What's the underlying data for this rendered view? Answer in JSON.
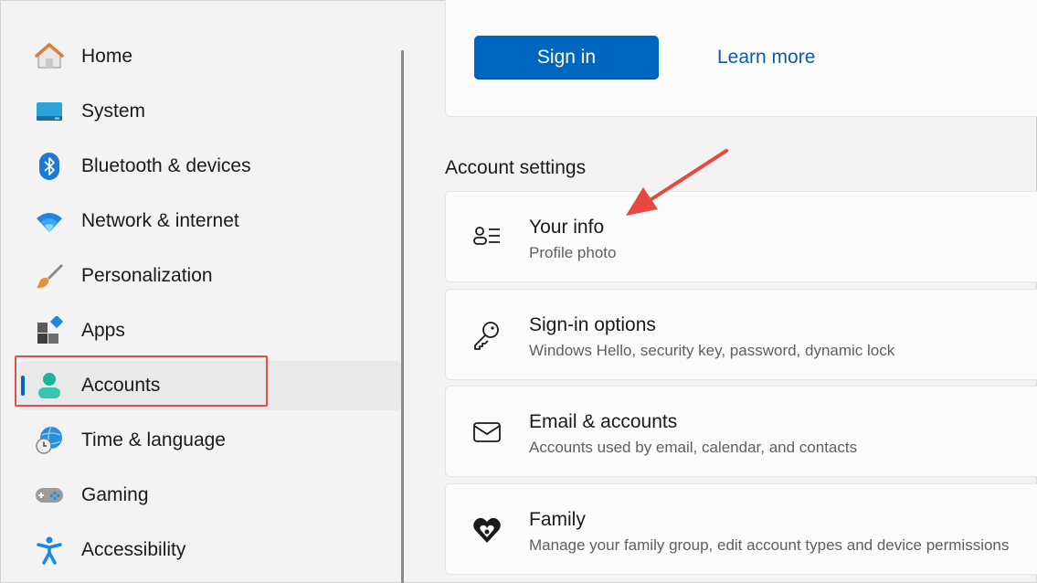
{
  "sidebar": {
    "items": [
      {
        "label": "Home",
        "icon": "home-icon"
      },
      {
        "label": "System",
        "icon": "system-icon"
      },
      {
        "label": "Bluetooth & devices",
        "icon": "bluetooth-icon"
      },
      {
        "label": "Network & internet",
        "icon": "wifi-icon"
      },
      {
        "label": "Personalization",
        "icon": "brush-icon"
      },
      {
        "label": "Apps",
        "icon": "apps-icon"
      },
      {
        "label": "Accounts",
        "icon": "accounts-icon",
        "active": true
      },
      {
        "label": "Time & language",
        "icon": "time-language-icon"
      },
      {
        "label": "Gaming",
        "icon": "gamepad-icon"
      },
      {
        "label": "Accessibility",
        "icon": "accessibility-icon"
      }
    ]
  },
  "main": {
    "signin_label": "Sign in",
    "learn_more_label": "Learn more",
    "section_title": "Account settings",
    "cards": [
      {
        "title": "Your info",
        "subtitle": "Profile photo",
        "icon": "person-list-icon"
      },
      {
        "title": "Sign-in options",
        "subtitle": "Windows Hello, security key, password, dynamic lock",
        "icon": "key-icon"
      },
      {
        "title": "Email & accounts",
        "subtitle": "Accounts used by email, calendar, and contacts",
        "icon": "mail-icon"
      },
      {
        "title": "Family",
        "subtitle": "Manage your family group, edit account types and device permissions",
        "icon": "family-heart-icon"
      }
    ]
  },
  "colors": {
    "accent": "#0067c0",
    "highlight": "#e0504a",
    "link": "#0e5aa8"
  }
}
